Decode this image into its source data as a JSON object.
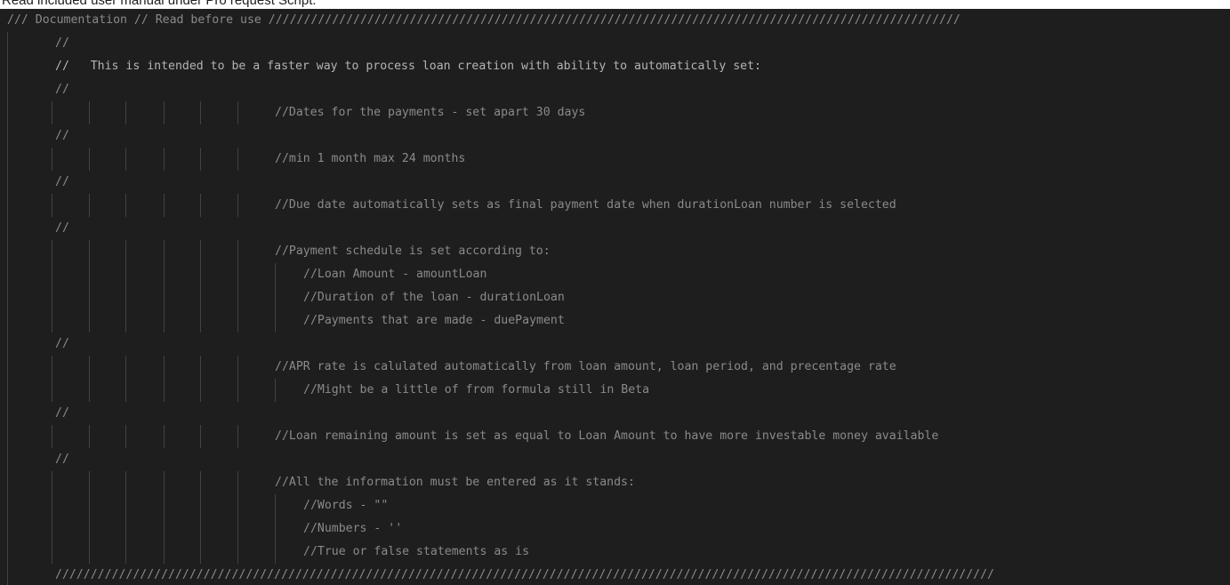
{
  "caption": "Read included user manual under Pro request Script.",
  "editor": {
    "lines": [
      "/// Documentation // Read before use //////////////////////////////////////////////////////////////////////////////////////////////////",
      "//",
      "//   This is intended to be a faster way to process loan creation with ability to automatically set:",
      "//",
      "//Dates for the payments - set apart 30 days",
      "//",
      "//min 1 month max 24 months",
      "//",
      "//Due date automatically sets as final payment date when durationLoan number is selected",
      "//",
      "//Payment schedule is set according to:",
      "//Loan Amount - amountLoan",
      "//Duration of the loan - durationLoan",
      "//Payments that are made - duePayment",
      "//",
      "//APR rate is calulated automatically from loan amount, loan period, and precentage rate",
      "//Might be a little of from formula still in Beta",
      "//",
      "//Loan remaining amount is set as equal to Loan Amount to have more investable money available",
      "//",
      "//All the information must be entered as it stands:",
      "//Words - \"\"",
      "//Numbers - ''",
      "//True or false statements as is",
      "/////////////////////////////////////////////////////////////////////////////////////////////////////////////////////////////////////"
    ]
  }
}
